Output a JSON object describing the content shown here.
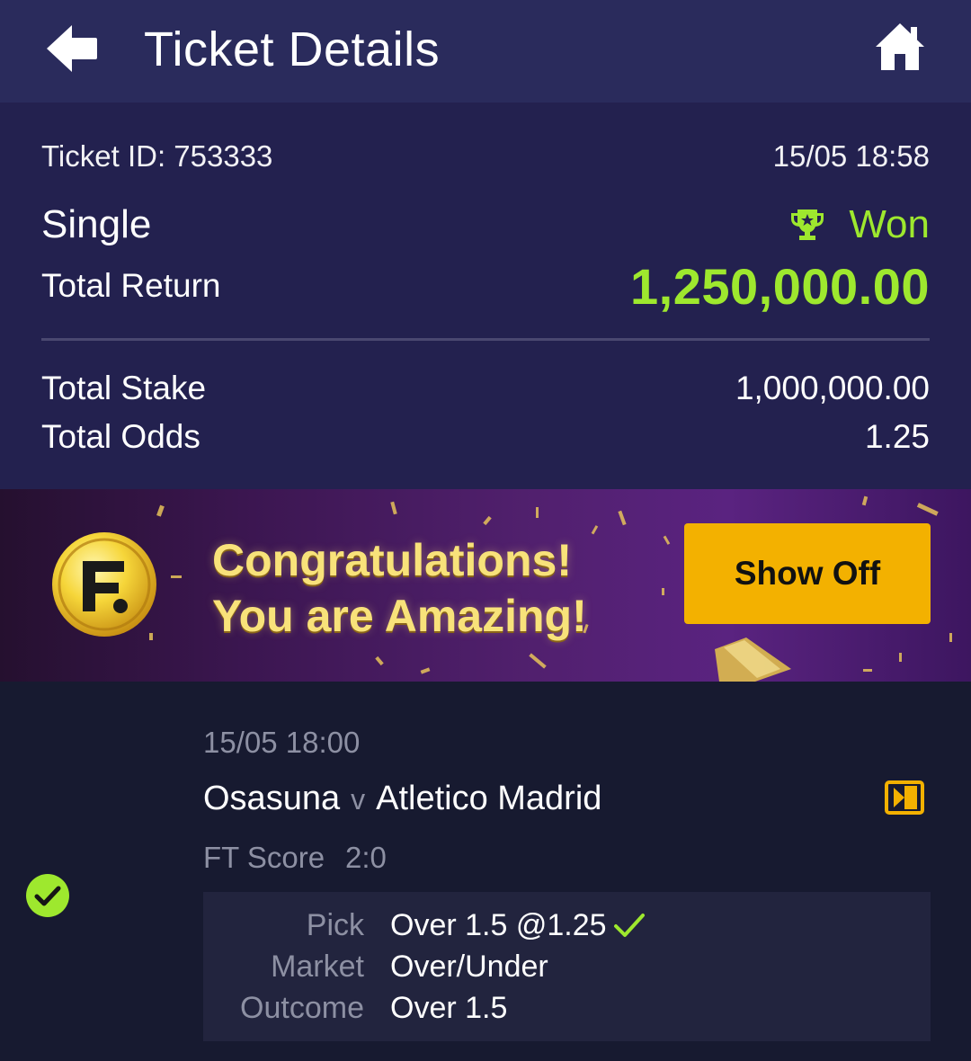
{
  "header": {
    "title": "Ticket Details",
    "back_icon": "back-arrow-icon",
    "home_icon": "home-icon"
  },
  "ticket": {
    "id_text": "Ticket ID: 753333",
    "datetime": "15/05 18:58",
    "bet_type": "Single",
    "status": "Won",
    "status_icon": "trophy-icon",
    "total_return_label": "Total Return",
    "total_return_value": "1,250,000.00",
    "total_stake_label": "Total Stake",
    "total_stake_value": "1,000,000.00",
    "total_odds_label": "Total Odds",
    "total_odds_value": "1.25"
  },
  "banner": {
    "line1": "Congratulations!",
    "line2": "You are Amazing!",
    "button_label": "Show Off",
    "logo_letter": "F"
  },
  "match": {
    "datetime": "15/05 18:00",
    "home_team": "Osasuna",
    "vs": "v",
    "away_team": "Atletico Madrid",
    "ft_label": "FT Score",
    "ft_score": "2:0",
    "pick_label": "Pick",
    "pick_value": "Over 1.5 @1.25",
    "market_label": "Market",
    "market_value": "Over/Under",
    "outcome_label": "Outcome",
    "outcome_value": "Over 1.5"
  },
  "colors": {
    "header_bg": "#2a2b5c",
    "summary_bg": "#23214f",
    "page_bg": "#171a30",
    "win_green": "#9ee82e",
    "button_yellow": "#f3b100",
    "muted_text": "#8d90a3"
  }
}
